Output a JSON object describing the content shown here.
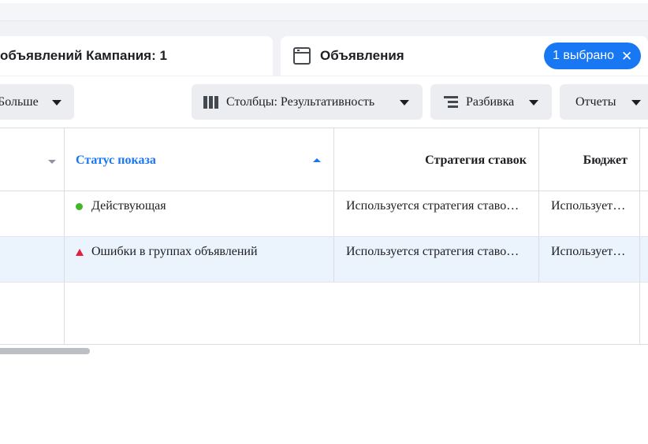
{
  "tabs": {
    "adsets_label": "объявлений Кампания: 1",
    "ads_label": "Объявления",
    "selected_label": "1 выбрано",
    "selected_close": "✕"
  },
  "toolbar": {
    "more_label": "Больше",
    "columns_label": "Столбцы: Результативность",
    "breakdown_label": "Разбивка",
    "reports_label": "Отчеты"
  },
  "table": {
    "headers": [
      "",
      "Статус показа",
      "Стратегия ставок",
      "Бюджет"
    ],
    "rows": [
      {
        "status": "Действующая",
        "status_icon": "green-dot-icon",
        "strategy": "Используется стратегия ставок группы объявлений",
        "budget": "Используется бюджет группы объявлений"
      },
      {
        "status": "Ошибки в группах объявлений",
        "status_icon": "red-warning-triangle-icon",
        "strategy": "Используется стратегия ставок группы объявлений",
        "budget": "Используется бюджет группы объявлений"
      }
    ]
  },
  "colors": {
    "accent": "#1877f2",
    "active_status": "#42b72a",
    "error_status": "#e41e3f",
    "selected_row": "#ebf3fd"
  }
}
